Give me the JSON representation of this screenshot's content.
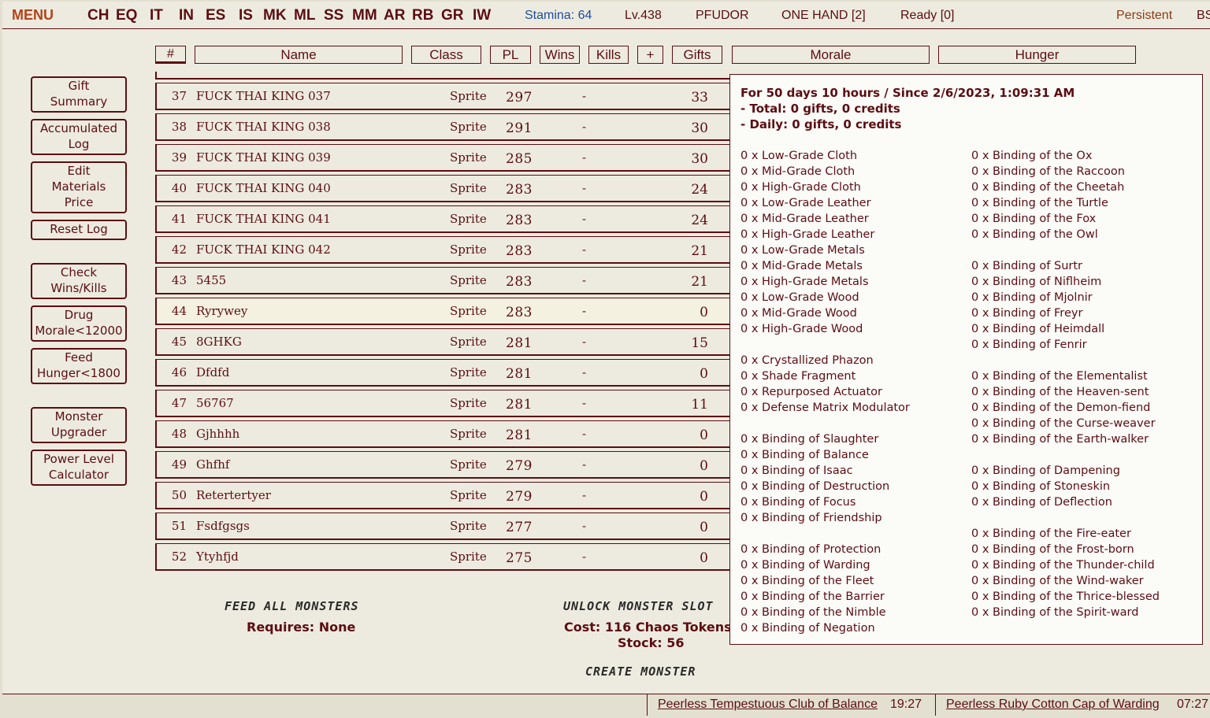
{
  "topbar": {
    "menu": "MENU",
    "nav": [
      "CH",
      "EQ",
      "IT",
      "IN",
      "ES",
      "IS",
      "MK",
      "ML",
      "SS",
      "MM",
      "AR",
      "RB",
      "GR",
      "IW"
    ],
    "stamina": "Stamina: 64",
    "level": "Lv.438",
    "difficulty": "PFUDOR",
    "style": "ONE HAND [2]",
    "ready": "Ready [0]",
    "persistent": "Persistent",
    "extra": "BS"
  },
  "headers": {
    "num": "#",
    "name": "Name",
    "class": "Class",
    "pl": "PL",
    "wins": "Wins",
    "kills": "Kills",
    "plus": "+",
    "gifts": "Gifts",
    "morale": "Morale",
    "hunger": "Hunger"
  },
  "sidebar": [
    {
      "label": "Gift\nSummary"
    },
    {
      "label": "Accumulated\nLog"
    },
    {
      "label": "Edit\nMaterials\nPrice"
    },
    {
      "label": "Reset Log"
    },
    {
      "label": "Check\nWins/Kills"
    },
    {
      "label": "Drug\nMorale<12000"
    },
    {
      "label": "Feed\nHunger<1800"
    },
    {
      "label": "Monster\nUpgrader"
    },
    {
      "label": "Power Level\nCalculator"
    }
  ],
  "monsters": [
    {
      "num": "37",
      "name": "FUCK THAI KING 037",
      "class": "Sprite",
      "pl": "297",
      "wins": "-",
      "gifts": "33"
    },
    {
      "num": "38",
      "name": "FUCK THAI KING 038",
      "class": "Sprite",
      "pl": "291",
      "wins": "-",
      "gifts": "30"
    },
    {
      "num": "39",
      "name": "FUCK THAI KING 039",
      "class": "Sprite",
      "pl": "285",
      "wins": "-",
      "gifts": "30"
    },
    {
      "num": "40",
      "name": "FUCK THAI KING 040",
      "class": "Sprite",
      "pl": "283",
      "wins": "-",
      "gifts": "24"
    },
    {
      "num": "41",
      "name": "FUCK THAI KING 041",
      "class": "Sprite",
      "pl": "283",
      "wins": "-",
      "gifts": "24"
    },
    {
      "num": "42",
      "name": "FUCK THAI KING 042",
      "class": "Sprite",
      "pl": "283",
      "wins": "-",
      "gifts": "21"
    },
    {
      "num": "43",
      "name": "5455",
      "class": "Sprite",
      "pl": "283",
      "wins": "-",
      "gifts": "21"
    },
    {
      "num": "44",
      "name": "Ryrywey",
      "class": "Sprite",
      "pl": "283",
      "wins": "-",
      "gifts": "0"
    },
    {
      "num": "45",
      "name": "8GHKG",
      "class": "Sprite",
      "pl": "281",
      "wins": "-",
      "gifts": "15"
    },
    {
      "num": "46",
      "name": "Dfdfd",
      "class": "Sprite",
      "pl": "281",
      "wins": "-",
      "gifts": "0"
    },
    {
      "num": "47",
      "name": "56767",
      "class": "Sprite",
      "pl": "281",
      "wins": "-",
      "gifts": "11"
    },
    {
      "num": "48",
      "name": "Gjhhhh",
      "class": "Sprite",
      "pl": "281",
      "wins": "-",
      "gifts": "0"
    },
    {
      "num": "49",
      "name": "Ghfhf",
      "class": "Sprite",
      "pl": "279",
      "wins": "-",
      "gifts": "0"
    },
    {
      "num": "50",
      "name": "Retertertyer",
      "class": "Sprite",
      "pl": "279",
      "wins": "-",
      "gifts": "0"
    },
    {
      "num": "51",
      "name": "Fsdfgsgs",
      "class": "Sprite",
      "pl": "277",
      "wins": "-",
      "gifts": "0"
    },
    {
      "num": "52",
      "name": "Ytyhfjd",
      "class": "Sprite",
      "pl": "275",
      "wins": "-",
      "gifts": "0"
    }
  ],
  "feed": {
    "title": "FEED ALL MONSTERS",
    "requires": "Requires: None"
  },
  "unlock": {
    "title": "UNLOCK MONSTER SLOT",
    "cost": "Cost: 116 Chaos Tokens",
    "stock": "Stock: 56"
  },
  "create": {
    "title": "CREATE MONSTER"
  },
  "popup": {
    "period": "For 50 days 10 hours / Since 2/6/2023, 1:09:31 AM",
    "total": "- Total: 0 gifts, 0 credits",
    "daily": "- Daily: 0 gifts, 0 credits",
    "col1": [
      "0 x Low-Grade Cloth",
      "0 x Mid-Grade Cloth",
      "0 x High-Grade Cloth",
      "0 x Low-Grade Leather",
      "0 x Mid-Grade Leather",
      "0 x High-Grade Leather",
      "0 x Low-Grade Metals",
      "0 x Mid-Grade Metals",
      "0 x High-Grade Metals",
      "0 x Low-Grade Wood",
      "0 x Mid-Grade Wood",
      "0 x High-Grade Wood",
      "",
      "0 x Crystallized Phazon",
      "0 x Shade Fragment",
      "0 x Repurposed Actuator",
      "0 x Defense Matrix Modulator",
      "",
      "0 x Binding of Slaughter",
      "0 x Binding of Balance",
      "0 x Binding of Isaac",
      "0 x Binding of Destruction",
      "0 x Binding of Focus",
      "0 x Binding of Friendship",
      "",
      "0 x Binding of Protection",
      "0 x Binding of Warding",
      "0 x Binding of the Fleet",
      "0 x Binding of the Barrier",
      "0 x Binding of the Nimble",
      "0 x Binding of Negation"
    ],
    "col2": [
      "0 x Binding of the Ox",
      "0 x Binding of the Raccoon",
      "0 x Binding of the Cheetah",
      "0 x Binding of the Turtle",
      "0 x Binding of the Fox",
      "0 x Binding of the Owl",
      "",
      "0 x Binding of Surtr",
      "0 x Binding of Niflheim",
      "0 x Binding of Mjolnir",
      "0 x Binding of Freyr",
      "0 x Binding of Heimdall",
      "0 x Binding of Fenrir",
      "",
      "0 x Binding of the Elementalist",
      "0 x Binding of the Heaven-sent",
      "0 x Binding of the Demon-fiend",
      "0 x Binding of the Curse-weaver",
      "0 x Binding of the Earth-walker",
      "",
      "0 x Binding of Dampening",
      "0 x Binding of Stoneskin",
      "0 x Binding of Deflection",
      "",
      "0 x Binding of the Fire-eater",
      "0 x Binding of the Frost-born",
      "0 x Binding of the Thunder-child",
      "0 x Binding of the Wind-waker",
      "0 x Binding of the Thrice-blessed",
      "0 x Binding of the Spirit-ward"
    ]
  },
  "statusbar": {
    "link1": "Peerless Tempestuous Club of Balance",
    "time1": "19:27",
    "link2": "Peerless Ruby Cotton Cap of Warding",
    "time2": "07:27"
  }
}
